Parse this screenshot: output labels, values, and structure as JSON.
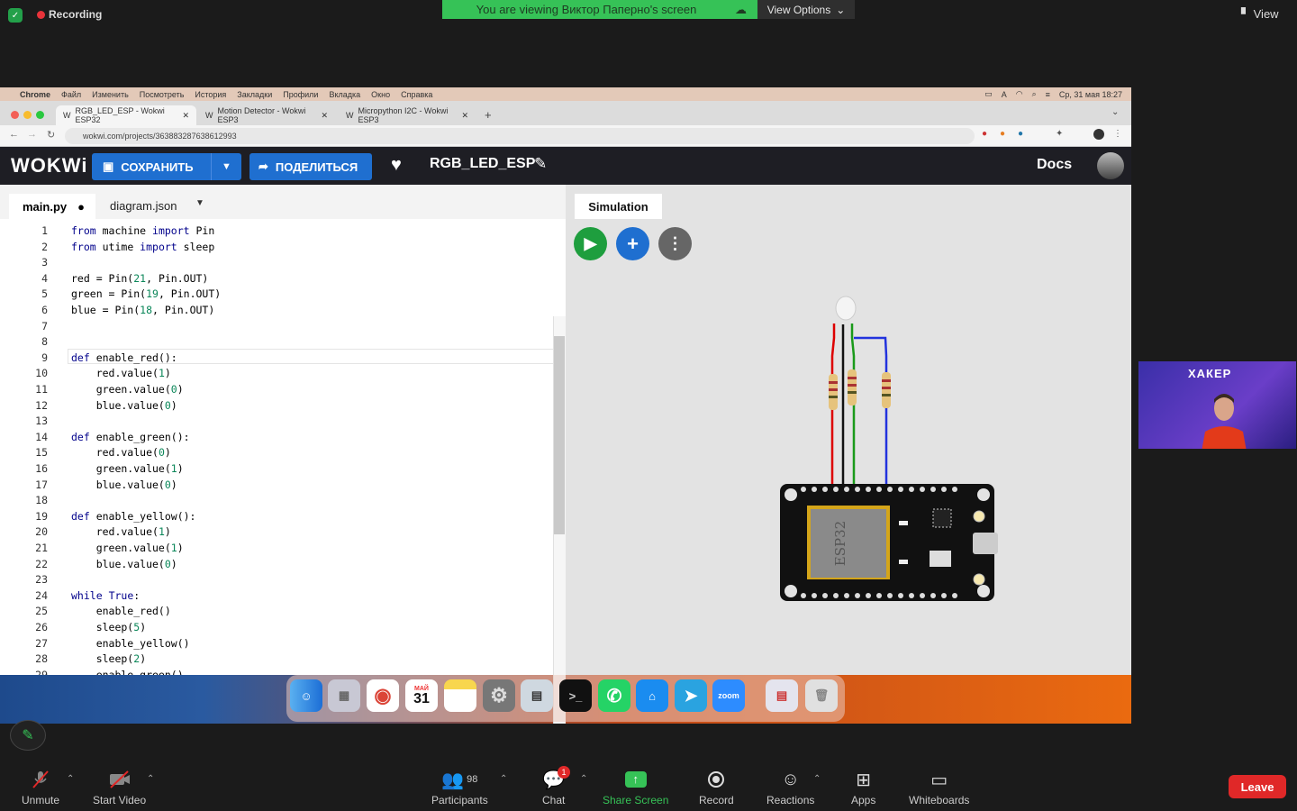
{
  "zoom_top": {
    "recording_label": "Recording",
    "viewing_banner": "You are viewing Виктор Паперно's screen",
    "view_options_label": "View Options",
    "view_label": "View"
  },
  "mac_menubar": {
    "items": [
      "Chrome",
      "Файл",
      "Изменить",
      "Посмотреть",
      "История",
      "Закладки",
      "Профили",
      "Вкладка",
      "Окно",
      "Справка"
    ],
    "clock": "Ср, 31 мая  18:27"
  },
  "chrome": {
    "tabs": [
      {
        "label": "RGB_LED_ESP - Wokwi ESP32",
        "active": true
      },
      {
        "label": "Motion Detector - Wokwi ESP3",
        "active": false
      },
      {
        "label": "Micropython I2C - Wokwi ESP3",
        "active": false
      }
    ],
    "url": "wokwi.com/projects/363883287638612993"
  },
  "wokwi": {
    "logo": "WOKWi",
    "save_label": "СОХРАНИТЬ",
    "share_label": "ПОДЕЛИТЬСЯ",
    "project_name": "RGB_LED_ESP",
    "docs_label": "Docs",
    "editor_tabs": {
      "main": "main.py",
      "diagram": "diagram.json"
    },
    "simulation_tab": "Simulation",
    "esp_label": "ESP32"
  },
  "code_lines": [
    "from machine import Pin",
    "from utime import sleep",
    "",
    "red = Pin(21, Pin.OUT)",
    "green = Pin(19, Pin.OUT)",
    "blue = Pin(18, Pin.OUT)",
    "",
    "",
    "def enable_red():",
    "    red.value(1)",
    "    green.value(0)",
    "    blue.value(0)",
    "",
    "def enable_green():",
    "    red.value(0)",
    "    green.value(1)",
    "    blue.value(0)",
    "",
    "def enable_yellow():",
    "    red.value(1)",
    "    green.value(1)",
    "    blue.value(0)",
    "",
    "while True:",
    "    enable_red()",
    "    sleep(5)",
    "    enable_yellow()",
    "    sleep(2)",
    "    enable_green()"
  ],
  "dock_icons": [
    "finder-icon",
    "launchpad-icon",
    "chrome-icon",
    "calendar-icon",
    "notes-icon",
    "settings-icon",
    "preview-icon",
    "terminal-icon",
    "whatsapp-icon",
    "keynote-icon",
    "telegram-icon",
    "zoom-icon",
    "downloads-icon",
    "trash-icon"
  ],
  "calendar": {
    "month": "МАЙ",
    "day": "31"
  },
  "dock_zoom_label": "zoom",
  "video_tile": {
    "logo": "ХАКЕР"
  },
  "zoom_toolbar": {
    "unmute": "Unmute",
    "start_video": "Start Video",
    "participants": "Participants",
    "participants_count": "98",
    "chat": "Chat",
    "chat_badge": "1",
    "share_screen": "Share Screen",
    "record": "Record",
    "reactions": "Reactions",
    "apps": "Apps",
    "whiteboards": "Whiteboards",
    "leave": "Leave"
  },
  "colors": {
    "zoom_green": "#36c257",
    "wokwi_blue": "#1f6fd0",
    "leave_red": "#e02828"
  }
}
